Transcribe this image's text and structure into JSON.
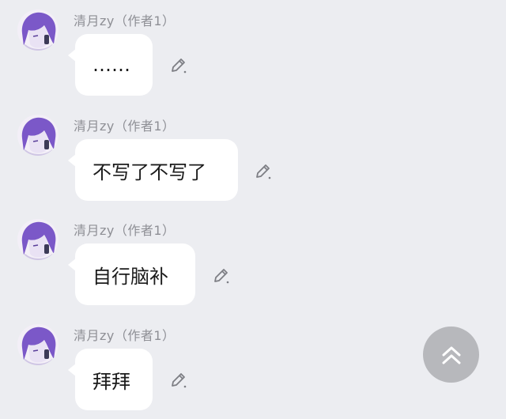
{
  "messages": [
    {
      "author": "清月zy（作者1）",
      "text": "……"
    },
    {
      "author": "清月zy（作者1）",
      "text": "不写了不写了"
    },
    {
      "author": "清月zy（作者1）",
      "text": "自行脑补"
    },
    {
      "author": "清月zy（作者1）",
      "text": "拜拜"
    }
  ],
  "icons": {
    "avatar": "anime-character-avatar",
    "edit": "pencil-edit-icon",
    "scroll_top": "double-chevron-up-icon"
  },
  "colors": {
    "background": "#ecedf1",
    "bubble": "#ffffff",
    "author_text": "#8e8f95",
    "message_text": "#1b1b1b",
    "avatar_accent": "#7a58c9",
    "scroll_button": "#b7b8bc"
  }
}
